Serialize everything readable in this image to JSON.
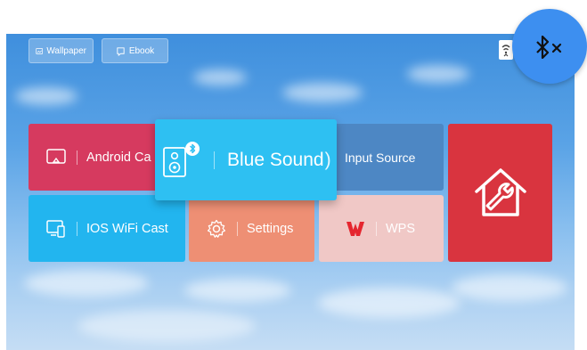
{
  "top_buttons": {
    "wallpaper": "Wallpaper",
    "ebook": "Ebook"
  },
  "tiles": {
    "android_cast": "Android Ca",
    "blue_sound": "Blue Sound",
    "input_source": "Input Source",
    "ios_wifi_cast": "IOS WiFi Cast",
    "settings": "Settings",
    "wps": "WPS"
  },
  "icons": {
    "wallpaper": "image-edit-icon",
    "ebook": "book-icon",
    "android_cast": "cast-icon",
    "blue_sound": "bluetooth-speaker-icon",
    "ios_wifi_cast": "mirror-cast-icon",
    "settings": "gear-icon",
    "wps": "wps-logo-icon",
    "home_tools": "home-wrench-icon",
    "status": "wifi-cast-icon",
    "bluetooth": "bluetooth-off-icon"
  },
  "colors": {
    "android_cast": "#d63a5f",
    "blue_sound": "#2ec0f2",
    "input_source": "#4d87c4",
    "ios_wifi_cast": "#22b5ef",
    "settings": "#ee8f74",
    "wps": "#f0c8c6",
    "home_tools": "#d9343f",
    "bluetooth_circle": "#3d8ff0"
  }
}
